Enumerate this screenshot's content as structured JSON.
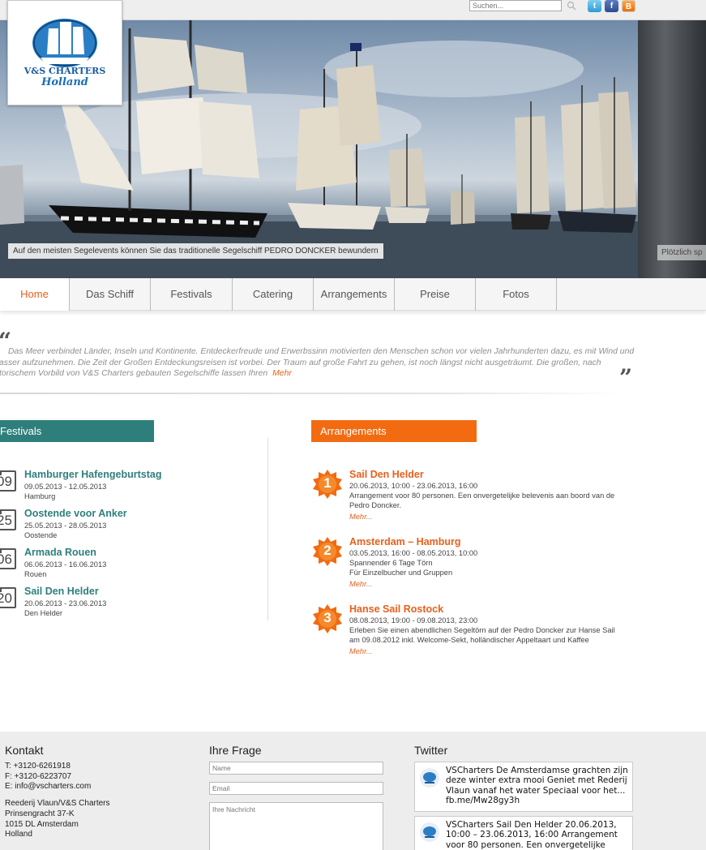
{
  "header": {
    "search_placeholder": "Suchen...",
    "logo": {
      "line1": "V&S CHARTERS",
      "line2": "Holland"
    },
    "social": {
      "twitter": "t",
      "facebook": "f",
      "blogger": "B"
    }
  },
  "hero": {
    "caption": "Auf den meisten Segelevents können Sie das traditionelle Segelschiff PEDRO DONCKER bewundern",
    "caption_next": "Plötzlich sp"
  },
  "nav": {
    "items": [
      {
        "label": "Home",
        "active": true
      },
      {
        "label": "Das Schiff"
      },
      {
        "label": "Festivals"
      },
      {
        "label": "Catering"
      },
      {
        "label": "Arrangements"
      },
      {
        "label": "Preise"
      },
      {
        "label": "Fotos"
      }
    ]
  },
  "quote": {
    "open_mark": "“",
    "close_mark": "”",
    "lines": [
      "Das Meer verbindet Länder, Inseln und Kontinente. Entdeckerfreude und Erwerbssinn motivierten den Menschen schon vor vielen Jahrhunderten dazu, es mit Wind und",
      "asser aufzunehmen. Die Zeit der Großen Entdeckungsreisen ist vorbei. Der Traum auf große Fahrt zu gehen, ist noch längst nicht ausgeträumt. Die großen, nach",
      "torischem Vorbild von V&S Charters gebauten Segelschiffe  lassen Ihren"
    ],
    "more": "Mehr"
  },
  "festivals": {
    "title": "Festivals",
    "items": [
      {
        "day": "09",
        "title": "Hamburger Hafengeburtstag",
        "dates": "09.05.2013 - 12.05.2013",
        "location": "Hamburg"
      },
      {
        "day": "25",
        "title": "Oostende voor Anker",
        "dates": "25.05.2013 - 28.05.2013",
        "location": "Oostende"
      },
      {
        "day": "06",
        "title": "Armada Rouen",
        "dates": "06.06.2013 - 16.06.2013",
        "location": "Rouen"
      },
      {
        "day": "20",
        "title": "Sail Den Helder",
        "dates": "20.06.2013 - 23.06.2013",
        "location": "Den Helder"
      }
    ]
  },
  "arrangements": {
    "title": "Arrangements",
    "items": [
      {
        "num": "1",
        "title": "Sail Den Helder",
        "dates": "20.06.2013, 10:00 - 23.06.2013, 16:00",
        "text": "Arrangement voor 80 personen. Een onvergetelijke belevenis aan boord van de Pedro Doncker.",
        "more": "Mehr..."
      },
      {
        "num": "2",
        "title": "Amsterdam – Hamburg",
        "dates": "03.05.2013, 16:00 - 08.05.2013, 10:00",
        "text": "Spannender 6 Tage  Törn",
        "text2": "Für Einzelbucher und Gruppen",
        "more": "Mehr..."
      },
      {
        "num": "3",
        "title": "Hanse Sail Rostock",
        "dates": "08.08.2013, 19:00 - 09.08.2013, 23:00",
        "text": "Erleben Sie einen  abendlichen  Segeltörn auf der Pedro Doncker zur Hanse Sail am 09.08.2012 inkl. Welcome-Sekt, holländischer Appeltaart und Kaffee",
        "more": "Mehr..."
      }
    ]
  },
  "footer": {
    "kontakt": {
      "title": "Kontakt",
      "phone": "T: +3120-6261918",
      "fax": "F: +3120-6223707",
      "email": "E: info@vscharters.com",
      "address": [
        "Reederij Vlaun/V&S Charters",
        "Prinsengracht 37-K",
        "1015 DL Amsterdam",
        "Holland"
      ]
    },
    "frage": {
      "title": "Ihre Frage",
      "name_placeholder": "Name",
      "email_placeholder": "Email",
      "message_placeholder": "Ihre Nachricht"
    },
    "twitter": {
      "title": "Twitter",
      "tweets": [
        "VSCharters De Amsterdamse grachten zijn deze winter extra mooi Geniet met Rederij Vlaun vanaf het water Speciaal voor het... fb.me/Mw28gy3h",
        "VSCharters Sail Den Helder 20.06.2013, 10:00 – 23.06.2013, 16:00 Arrangement voor 80 personen. Een onvergetelijke"
      ]
    }
  },
  "colors": {
    "accent_orange": "#f26b11",
    "accent_teal": "#2e7f7b"
  }
}
